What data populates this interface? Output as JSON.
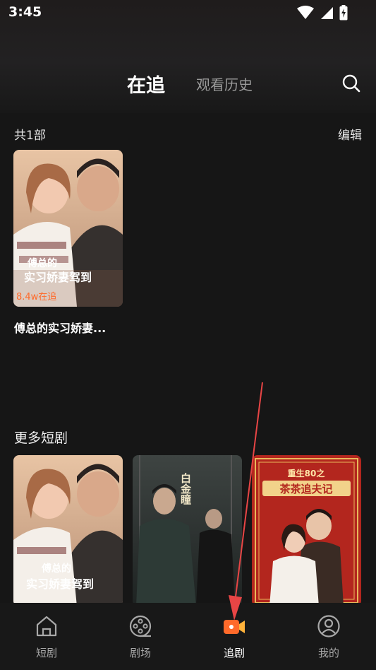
{
  "status_bar": {
    "time": "3:45"
  },
  "header": {
    "tabs": [
      {
        "label": "在追",
        "active": true
      },
      {
        "label": "观看历史",
        "active": false
      }
    ]
  },
  "following": {
    "count_text": "共1部",
    "edit_label": "编辑",
    "items": [
      {
        "title": "傅总的实习娇妻...",
        "poster_title_line1": "傅总的",
        "poster_title_line2": "实习娇妻驾到",
        "badge": "8.4w在追"
      }
    ]
  },
  "more": {
    "heading": "更多短剧",
    "items": [
      {
        "poster_title_line1": "傅总的",
        "poster_title_line2": "实习娇妻驾到"
      },
      {
        "poster_title": "白金瞳"
      },
      {
        "poster_title_top": "重生80之",
        "poster_title_main": "茶茶追夫记"
      }
    ]
  },
  "bottom_nav": {
    "items": [
      {
        "label": "短剧",
        "icon": "home-icon",
        "active": false
      },
      {
        "label": "剧场",
        "icon": "film-reel-icon",
        "active": false
      },
      {
        "label": "追剧",
        "icon": "video-camera-icon",
        "active": true
      },
      {
        "label": "我的",
        "icon": "profile-icon",
        "active": false
      }
    ]
  },
  "colors": {
    "background": "#161616",
    "accent": "#ff6a2a",
    "annotation": "#e84545"
  }
}
